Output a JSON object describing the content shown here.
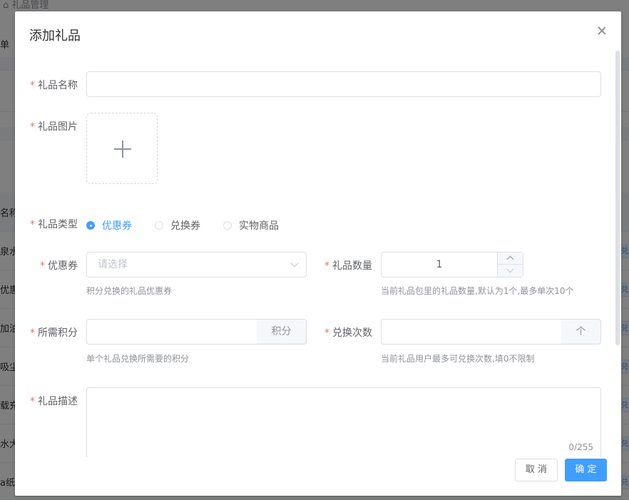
{
  "background": {
    "breadcrumb": "礼品管理",
    "menu_fragment": "单",
    "column_header_fragment": "名称",
    "row_fragments": [
      "泉水",
      "优惠",
      "加油",
      "吸尘",
      "载充",
      "水大",
      "a纸"
    ],
    "tag_fragment": "兑"
  },
  "dialog": {
    "title": "添加礼品",
    "form": {
      "name": {
        "label": "礼品名称",
        "value": ""
      },
      "image": {
        "label": "礼品图片"
      },
      "type": {
        "label": "礼品类型",
        "options": [
          "优惠券",
          "兑换券",
          "实物商品"
        ],
        "selected": "优惠券"
      },
      "coupon": {
        "label": "优惠券",
        "placeholder": "请选择",
        "help": "积分兑换的礼品优惠券"
      },
      "quantity": {
        "label": "礼品数量",
        "value": "1",
        "help": "当前礼品包里的礼品数量,默认为1个,最多单次10个"
      },
      "points": {
        "label": "所需积分",
        "value": "",
        "append": "积分",
        "help": "单个礼品兑换所需要的积分"
      },
      "redeem_times": {
        "label": "兑换次数",
        "value": "",
        "append": "个",
        "help": "当前礼品用户最多可兑换次数,填0不限制"
      },
      "description": {
        "label": "礼品描述",
        "value": "",
        "counter": "0/255"
      }
    },
    "buttons": {
      "cancel": "取 消",
      "confirm": "确 定"
    }
  },
  "colors": {
    "primary": "#409eff",
    "required": "#f56c6c",
    "border": "#dcdfe6",
    "help_text": "#909399"
  }
}
